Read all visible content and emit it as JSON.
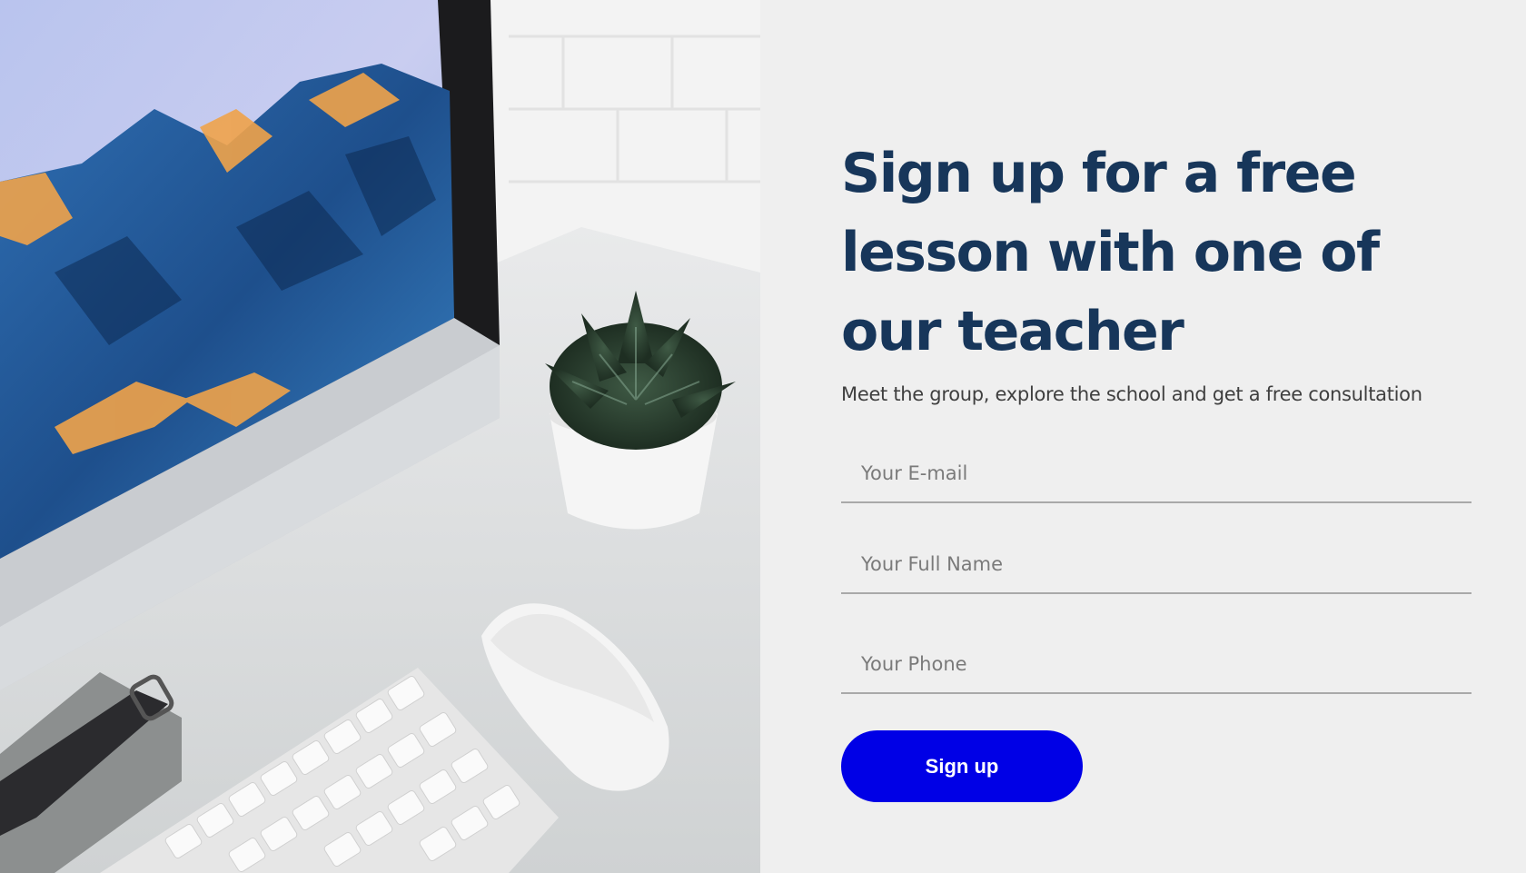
{
  "hero": {
    "heading": "Sign up for a free lesson with one of our teacher",
    "subtitle": "Meet the group, explore the school and get a free consultation"
  },
  "form": {
    "email_placeholder": "Your E-mail",
    "name_placeholder": "Your Full Name",
    "phone_placeholder": "Your Phone",
    "submit_label": "Sign up"
  },
  "colors": {
    "heading": "#17365a",
    "button": "#0000e6",
    "background": "#efefef"
  }
}
